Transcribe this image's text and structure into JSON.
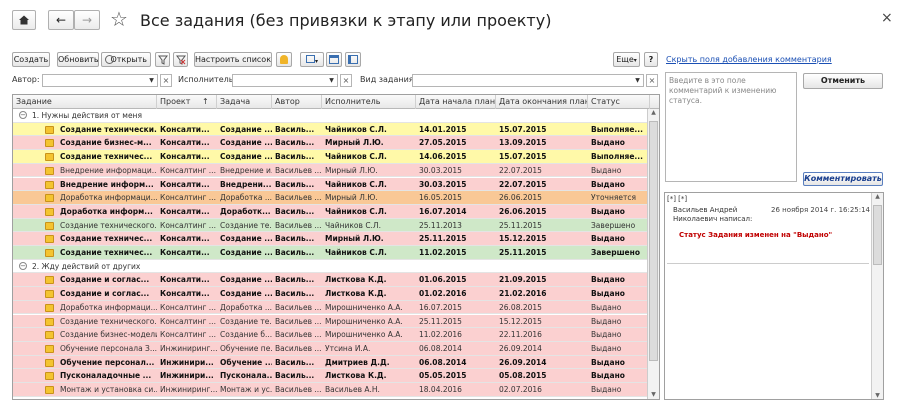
{
  "nav": {
    "home_icon": "home-icon",
    "back": "←",
    "forward": "→",
    "star": "☆"
  },
  "title": "Все задания (без привязки к этапу или проекту)",
  "close": "×",
  "toolbar": {
    "create": "Создать",
    "refresh": "Обновить",
    "open": "Открыть",
    "setup": "Настроить список...",
    "more": "Еще",
    "help": "?"
  },
  "filters": {
    "author_label": "Автор:",
    "executor_label": "Исполнитель:",
    "type_label": "Вид задания:"
  },
  "right": {
    "hide_link": "Скрыть поля добавления комментария",
    "placeholder": "Введите в это поле комментарий к изменению статуса.",
    "cancel": "Отменить",
    "comment": "Комментировать"
  },
  "history": {
    "head": "[*] [*]",
    "author": "Васильев Андрей Николаевич написал:",
    "date": "26 ноября 2014 г. 16:25:14",
    "message": "Статус Задания изменен на \"Выдано\""
  },
  "columns": [
    "Задание",
    "Проект",
    "Задача",
    "Автор",
    "Исполнитель",
    "Дата начала план",
    "Дата окончания план",
    "Статус"
  ],
  "sort_arrow": "↑",
  "groups": [
    {
      "label": "1. Нужны действия от меня",
      "rows": [
        {
          "c": [
            "Создание технически...",
            "Консалти...",
            "Создание ...",
            "Василь...",
            "Чайников С.Л.",
            "14.01.2015",
            "15.07.2015",
            "Выполняе..."
          ],
          "bg": "#fff9a8",
          "bold": true
        },
        {
          "c": [
            "Создание бизнес-м...",
            "Консалти...",
            "Создание ...",
            "Василь...",
            "Мирный Л.Ю.",
            "27.05.2015",
            "13.09.2015",
            "Выдано"
          ],
          "bg": "#fbd0d0",
          "bold": true
        },
        {
          "c": [
            "Создание техничес...",
            "Консалти...",
            "Создание ...",
            "Василь...",
            "Чайников С.Л.",
            "14.06.2015",
            "15.07.2015",
            "Выполняе..."
          ],
          "bg": "#fff9a8",
          "bold": true
        },
        {
          "c": [
            "Внедрение информаци...",
            "Консалтинг ...",
            "Внедрение и...",
            "Васильев ...",
            "Мирный Л.Ю.",
            "30.03.2015",
            "22.07.2015",
            "Выдано"
          ],
          "bg": "#fbd0d0",
          "bold": false
        },
        {
          "c": [
            "Внедрение информ...",
            "Консалти...",
            "Внедрени...",
            "Василь...",
            "Чайников С.Л.",
            "30.03.2015",
            "22.07.2015",
            "Выдано"
          ],
          "bg": "#fbd0d0",
          "bold": true
        },
        {
          "c": [
            "Доработка информаци...",
            "Консалтинг ...",
            "Доработка ...",
            "Васильев ...",
            "Мирный Л.Ю.",
            "16.05.2015",
            "26.06.2015",
            "Уточняется"
          ],
          "bg": "#f9c896",
          "bold": false
        },
        {
          "c": [
            "Доработка информ...",
            "Консалти...",
            "Доработк...",
            "Василь...",
            "Чайников С.Л.",
            "16.07.2014",
            "26.06.2015",
            "Выдано"
          ],
          "bg": "#fbd0d0",
          "bold": true
        },
        {
          "c": [
            "Создание технического...",
            "Консалтинг ...",
            "Создание те...",
            "Васильев ...",
            "Чайников С.Л.",
            "25.11.2013",
            "25.11.2015",
            "Завершено"
          ],
          "bg": "#cfe8c8",
          "bold": false
        },
        {
          "c": [
            "Создание техничес...",
            "Консалти...",
            "Создание ...",
            "Василь...",
            "Мирный Л.Ю.",
            "25.11.2015",
            "15.12.2015",
            "Выдано"
          ],
          "bg": "#fbd0d0",
          "bold": true
        },
        {
          "c": [
            "Создание техничес...",
            "Консалти...",
            "Создание ...",
            "Василь...",
            "Чайников С.Л.",
            "11.02.2015",
            "25.11.2015",
            "Завершено"
          ],
          "bg": "#cfe8c8",
          "bold": true
        }
      ]
    },
    {
      "label": "2. Жду действий от других",
      "rows": [
        {
          "c": [
            "Создание и соглас...",
            "Консалти...",
            "Создание ...",
            "Василь...",
            "Листкова К.Д.",
            "01.06.2015",
            "21.09.2015",
            "Выдано"
          ],
          "bg": "#fbd0d0",
          "bold": true
        },
        {
          "c": [
            "Создание и соглас...",
            "Консалти...",
            "Создание ...",
            "Василь...",
            "Листкова К.Д.",
            "01.02.2016",
            "21.02.2016",
            "Выдано"
          ],
          "bg": "#fbd0d0",
          "bold": true
        },
        {
          "c": [
            "Доработка информаци...",
            "Консалтинг ...",
            "Доработка ...",
            "Васильев ...",
            "Мирошниченко А.А.",
            "16.07.2015",
            "26.08.2015",
            "Выдано"
          ],
          "bg": "#fbd0d0",
          "bold": false
        },
        {
          "c": [
            "Создание технического...",
            "Консалтинг ...",
            "Создание те...",
            "Васильев ...",
            "Мирошниченко А.А.",
            "25.11.2015",
            "15.12.2015",
            "Выдано"
          ],
          "bg": "#fbd0d0",
          "bold": false
        },
        {
          "c": [
            "Создание бизнес-модели...",
            "Консалтинг ...",
            "Создание б...",
            "Васильев ...",
            "Мирошниченко А.А.",
            "11.02.2016",
            "22.11.2016",
            "Выдано"
          ],
          "bg": "#fbd0d0",
          "bold": false
        },
        {
          "c": [
            "Обучение персонала З...",
            "Инжиниринг...",
            "Обучение пе...",
            "Васильев ...",
            "Утсина И.А.",
            "06.08.2014",
            "26.09.2014",
            "Выдано"
          ],
          "bg": "#fbd0d0",
          "bold": false
        },
        {
          "c": [
            "Обучение персонал...",
            "Инжинири...",
            "Обучение ...",
            "Василь...",
            "Дмитриев Д.Д.",
            "06.08.2014",
            "26.09.2014",
            "Выдано"
          ],
          "bg": "#fbd0d0",
          "bold": true
        },
        {
          "c": [
            "Пусконаладочные ...",
            "Инжинири...",
            "Пусконала...",
            "Василь...",
            "Листкова К.Д.",
            "05.05.2015",
            "05.08.2015",
            "Выдано"
          ],
          "bg": "#fbd0d0",
          "bold": true
        },
        {
          "c": [
            "Монтаж и установка си...",
            "Инжиниринг...",
            "Монтаж и ус...",
            "Васильев ...",
            "Васильев А.Н.",
            "18.04.2016",
            "02.07.2016",
            "Выдано"
          ],
          "bg": "#fbd0d0",
          "bold": false
        }
      ]
    }
  ]
}
